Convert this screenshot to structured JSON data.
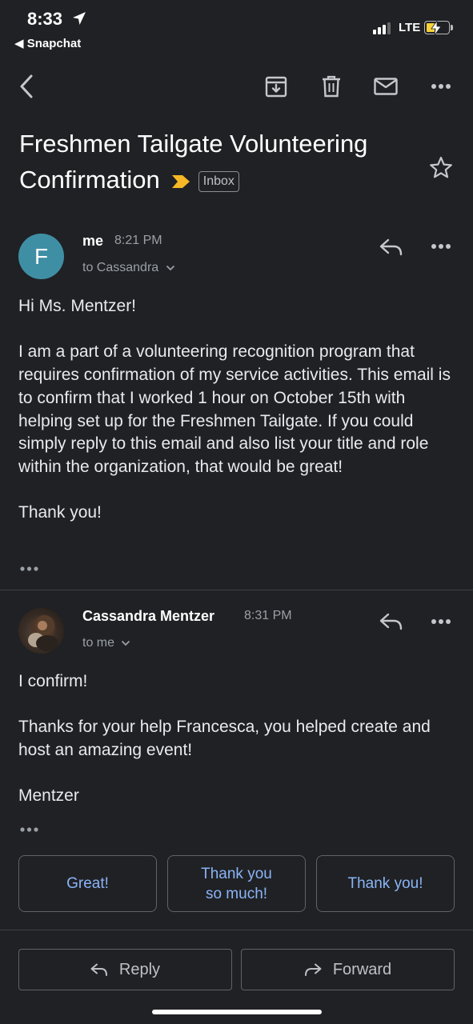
{
  "status_bar": {
    "time": "8:33",
    "back_app": "◀ Snapchat",
    "network": "LTE"
  },
  "toolbar": {
    "back_icon": "back-arrow-icon",
    "archive_icon": "archive-icon",
    "delete_icon": "trash-icon",
    "mark_unread_icon": "mail-icon",
    "more_icon": "more-horizontal-icon"
  },
  "subject": {
    "title": "Freshmen Tailgate Volunteering Confirmation",
    "label": "Inbox",
    "important_color": "#f6b826"
  },
  "messages": [
    {
      "avatar_letter": "F",
      "avatar_color": "#3f8fa4",
      "sender": "me",
      "time": "8:21 PM",
      "to": "to Cassandra",
      "body": [
        "Hi Ms. Mentzer!",
        "I am a part of a volunteering recognition program that requires confirmation of my service activities. This email is to confirm that I worked 1 hour on October 15th with helping set up for the Freshmen Tailgate. If you could simply reply to this email and also list your title and role within the organization, that would be great!",
        "Thank you!"
      ]
    },
    {
      "sender": "Cassandra Mentzer",
      "time": "8:31 PM",
      "to": "to me",
      "body": [
        "I confirm!",
        "Thanks for your help Francesca, you helped create and host an amazing event!",
        "Mentzer"
      ]
    }
  ],
  "smart_replies": [
    "Great!",
    "Thank you so much!",
    "Thank you!"
  ],
  "actions": {
    "reply": "Reply",
    "forward": "Forward"
  },
  "colors": {
    "background": "#202124",
    "link_blue": "#8ab4f8"
  }
}
